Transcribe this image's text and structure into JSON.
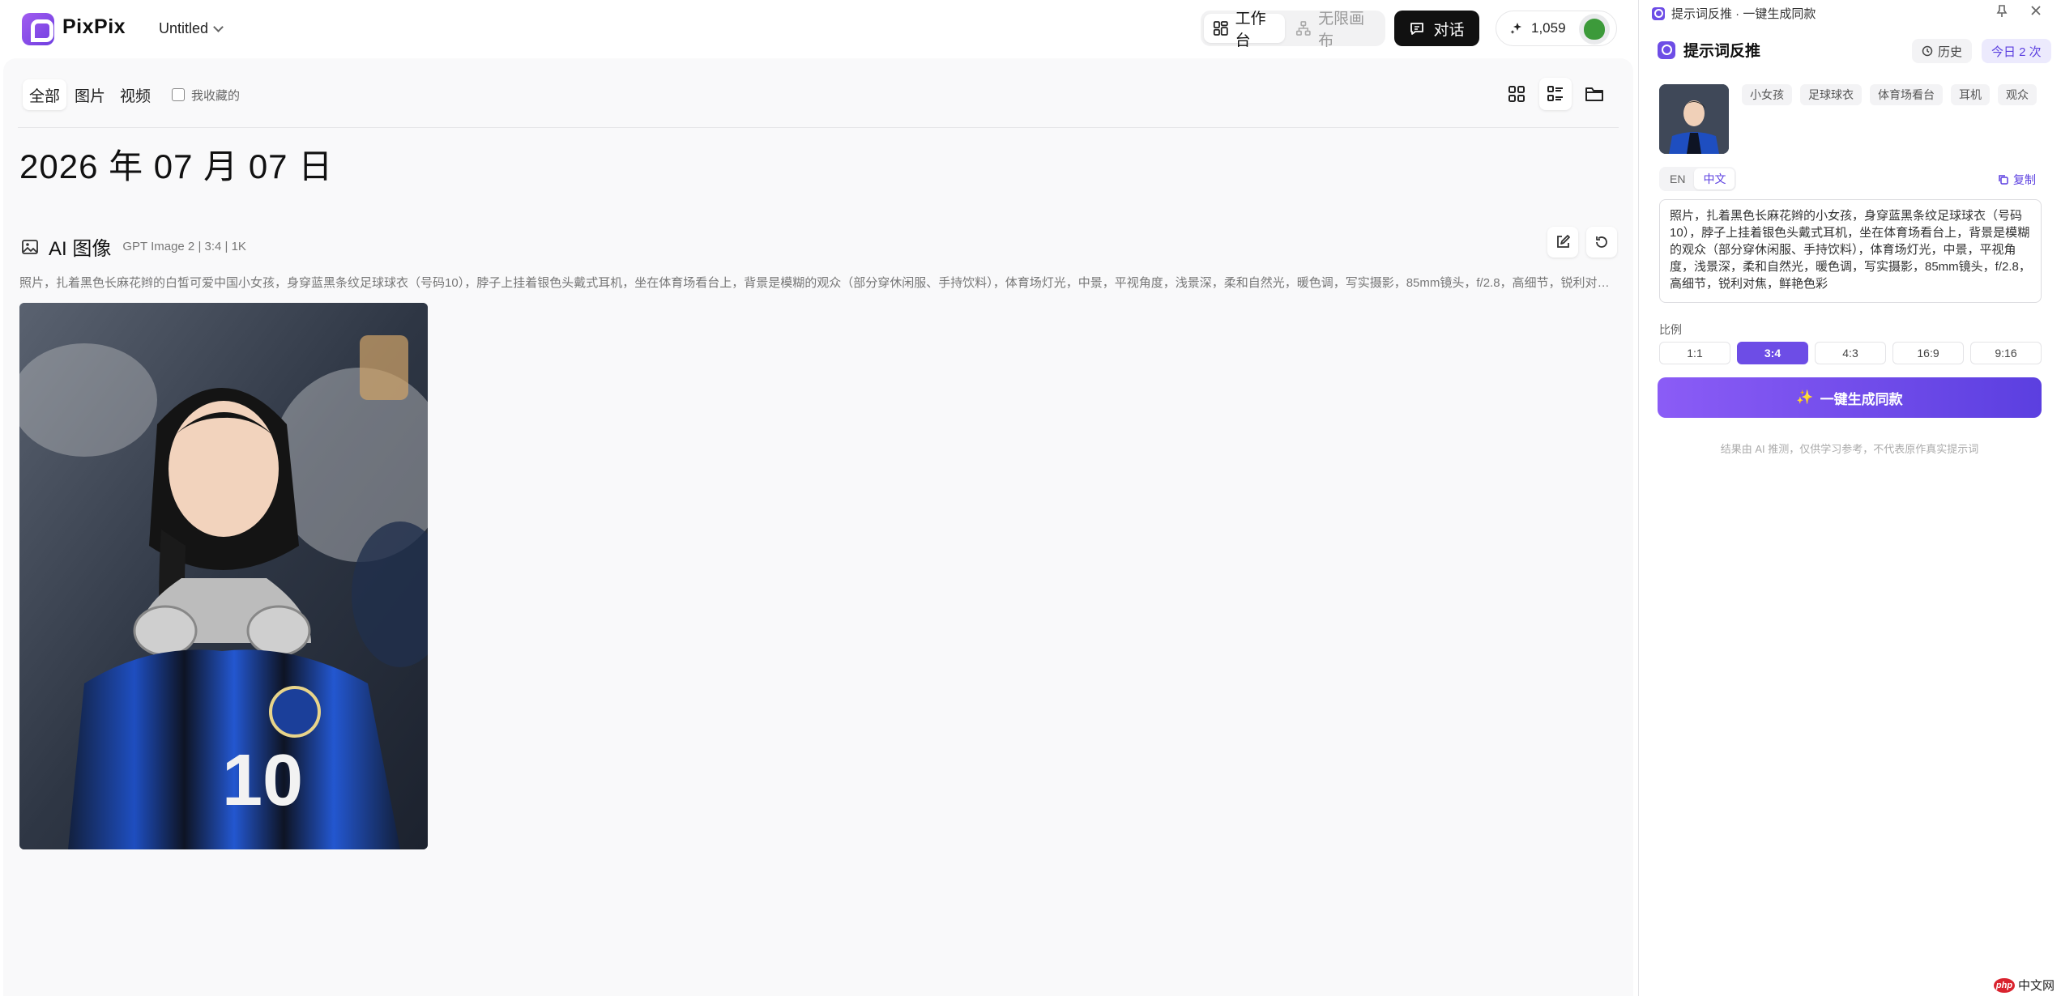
{
  "app": {
    "name": "PixPix",
    "doc_title": "Untitled"
  },
  "topbar": {
    "modes": [
      "工作台",
      "无限画布"
    ],
    "chat_label": "对话",
    "credits": "1,059"
  },
  "filters": {
    "tabs": [
      "全部",
      "图片",
      "视频"
    ],
    "favorites_label": "我收藏的"
  },
  "feed": {
    "date": "2026 年 07 月 07 日",
    "section_title": "AI 图像",
    "section_meta": "GPT Image 2 | 3:4 | 1K",
    "prompt": "照片，扎着黑色长麻花辫的白皙可爱中国小女孩，身穿蓝黑条纹足球球衣（号码10），脖子上挂着银色头戴式耳机，坐在体育场看台上，背景是模糊的观众（部分穿休闲服、手持饮料），体育场灯光，中景，平视角度，浅景深，柔和自然光，暖色调，写实摄影，85mm镜头，f/2.8，高细节，锐利对焦，鲜艳色彩"
  },
  "panel": {
    "window_title": "提示词反推 · 一键生成同款",
    "title": "提示词反推",
    "history_label": "历史",
    "today_label": "今日 2 次",
    "tags": [
      "小女孩",
      "足球球衣",
      "体育场看台",
      "耳机",
      "观众"
    ],
    "lang": [
      "EN",
      "中文"
    ],
    "copy_label": "复制",
    "prompt_text": "照片，扎着黑色长麻花辫的小女孩，身穿蓝黑条纹足球球衣（号码10），脖子上挂着银色头戴式耳机，坐在体育场看台上，背景是模糊的观众（部分穿休闲服、手持饮料），体育场灯光，中景，平视角度，浅景深，柔和自然光，暖色调，写实摄影，85mm镜头，f/2.8，高细节，锐利对焦，鲜艳色彩",
    "ratio_label": "比例",
    "ratios": [
      "1:1",
      "3:4",
      "4:3",
      "16:9",
      "9:16"
    ],
    "generate_label": "一键生成同款",
    "disclaimer": "结果由 AI 推测，仅供学习参考，不代表原作真实提示词"
  },
  "watermark": {
    "badge": "php",
    "text": "中文网"
  },
  "colors": {
    "accent": "#6d4de6",
    "brand": "#7c4ae8"
  }
}
